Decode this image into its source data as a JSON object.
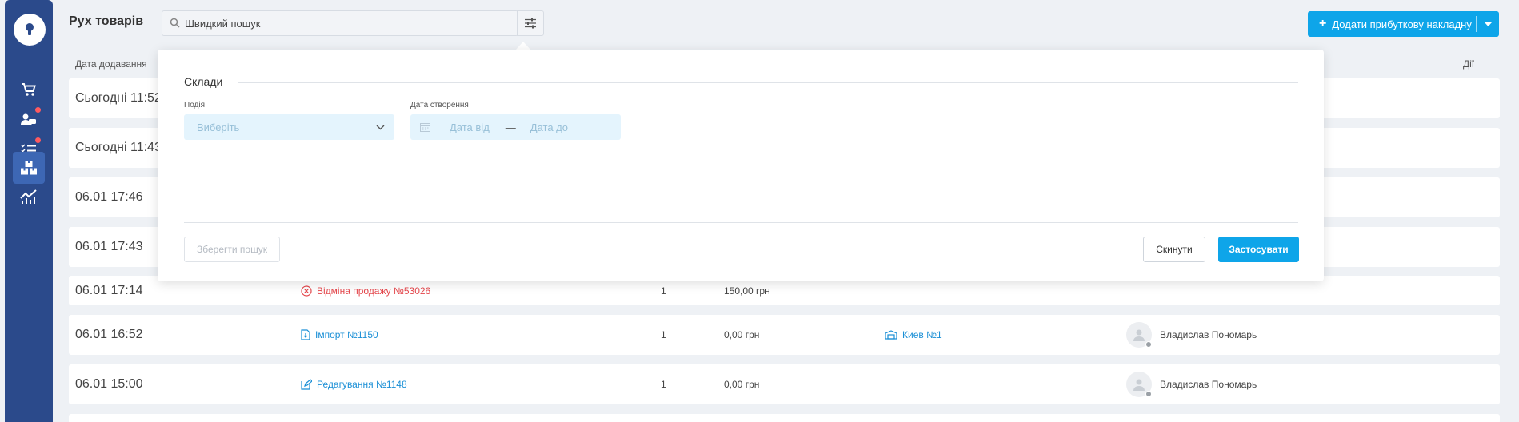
{
  "header": {
    "title": "Рух товарів",
    "search_placeholder": "Швидкий пошук",
    "add_button_label": "Додати прибуткову накладну"
  },
  "table": {
    "col_date": "Дата додавання",
    "col_actions": "Дії",
    "rows": [
      {
        "date": "Сьогодні 11:52"
      },
      {
        "date": "Сьогодні 11:43"
      },
      {
        "date": "06.01 17:46"
      },
      {
        "date": "06.01 17:43"
      },
      {
        "date": "06.01 17:14",
        "event": "Відміна продажу №53026",
        "event_icon": "cancel-circle-icon",
        "event_color": "#e5484d",
        "qty": "1",
        "sum": "150,00 грн"
      },
      {
        "date": "06.01 16:52",
        "event": "Імпорт №1150",
        "event_icon": "import-file-icon",
        "qty": "1",
        "sum": "0,00 грн",
        "warehouse": "Киев №1",
        "user": "Владислав Пономарь"
      },
      {
        "date": "06.01 15:00",
        "event": "Редагування №1148",
        "event_icon": "edit-icon",
        "qty": "1",
        "sum": "0,00 грн",
        "user": "Владислав Пономарь"
      }
    ]
  },
  "filter_popup": {
    "section_title": "Склади",
    "event_label": "Подія",
    "event_placeholder": "Виберіть",
    "created_label": "Дата створення",
    "date_from": "Дата від",
    "date_separator": "—",
    "date_to": "Дата до",
    "save_search": "Зберегти пошук",
    "reset": "Скинути",
    "apply": "Застосувати"
  },
  "colors": {
    "sidebar": "#2b4a8b",
    "accent": "#0ea5e9",
    "link": "#1a8fd6",
    "danger": "#e5484d"
  }
}
